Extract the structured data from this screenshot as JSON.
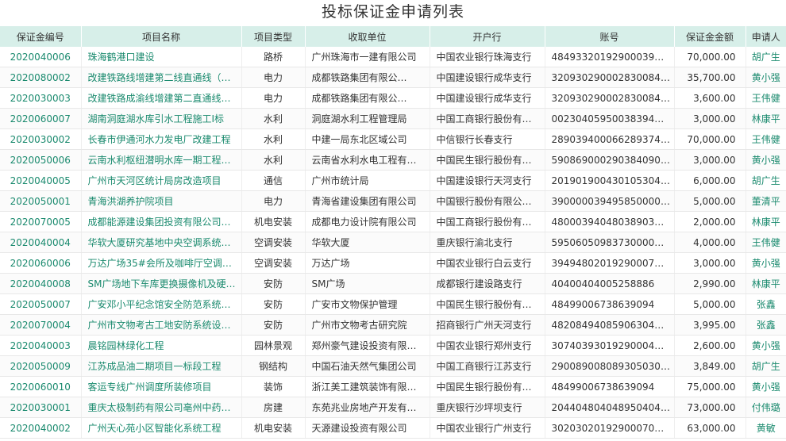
{
  "title": "投标保证金申请列表",
  "columns": [
    "保证金编号",
    "项目名称",
    "项目类型",
    "收取单位",
    "开户行",
    "账号",
    "保证金金额",
    "申请人"
  ],
  "rows": [
    {
      "code": "2020040006",
      "name": "珠海鹤港口建设",
      "type": "路桥",
      "unit": "广州珠海市一建有限公司",
      "bank": "中国农业银行珠海支行",
      "account": "48493320192900039…",
      "amount": "70,000.00",
      "applicant": "胡广生"
    },
    {
      "code": "2020080002",
      "name": "改建铁路线增建第二线直通线（…",
      "type": "电力",
      "unit": "成都铁路集团有限公…",
      "bank": "中国建设银行成华支行",
      "account": "32093029000283008404",
      "amount": "35,700.00",
      "applicant": "黄小强"
    },
    {
      "code": "2020030003",
      "name": "改建铁路成渝线增建第二直通线…",
      "type": "电力",
      "unit": "成都铁路集团有限公…",
      "bank": "中国建设银行成华支行",
      "account": "32093029000283008404",
      "amount": "3,600.00",
      "applicant": "王伟健"
    },
    {
      "code": "2020060007",
      "name": "湖南洞庭湖水库引水工程施工I标",
      "type": "水利",
      "unit": "洞庭湖水利工程管理局",
      "bank": "中国工商银行股份有…",
      "account": "00230405950038394…",
      "amount": "3,000.00",
      "applicant": "林康平"
    },
    {
      "code": "2020030002",
      "name": "长春市伊通河水力发电厂改建工程",
      "type": "水利",
      "unit": "中建一局东北区域公司",
      "bank": "中信银行长春支行",
      "account": "28903940006628937495",
      "amount": "70,000.00",
      "applicant": "王伟健"
    },
    {
      "code": "2020050006",
      "name": "云南水利枢纽潜明水库一期工程…",
      "type": "水利",
      "unit": "云南省水利水电工程有…",
      "bank": "中国民生银行股份有…",
      "account": "59086900029038409094",
      "amount": "3,000.00",
      "applicant": "黄小强"
    },
    {
      "code": "2020040005",
      "name": "广州市天河区统计局房改造项目",
      "type": "通信",
      "unit": "广州市统计局",
      "bank": "中国建设银行天河支行",
      "account": "20190190043010530494",
      "amount": "6,000.00",
      "applicant": "胡广生"
    },
    {
      "code": "2020050001",
      "name": "青海洪湖养护院项目",
      "type": "电力",
      "unit": "青海省建设集团有限公司",
      "bank": "中国银行股份有限公…",
      "account": "39000003949585000000",
      "amount": "5,000.00",
      "applicant": "董清平"
    },
    {
      "code": "2020070005",
      "name": "成都能源建设集团投资有限公司…",
      "type": "机电安装",
      "unit": "成都电力设计院有限公司",
      "bank": "中国工商银行股份有…",
      "account": "48000394048038903…",
      "amount": "2,000.00",
      "applicant": "林康平"
    },
    {
      "code": "2020040004",
      "name": "华软大厦研究基地中央空调系统…",
      "type": "空调安装",
      "unit": "华软大厦",
      "bank": "重庆银行渝北支行",
      "account": "59506050983730000…",
      "amount": "4,000.00",
      "applicant": "王伟健"
    },
    {
      "code": "2020060006",
      "name": "万达广场35#会所及咖啡厅空调安…",
      "type": "空调安装",
      "unit": "万达广场",
      "bank": "中国农业银行白云支行",
      "account": "39494802019290007…",
      "amount": "3,000.00",
      "applicant": "黄小强"
    },
    {
      "code": "2020040008",
      "name": "SM广场地下车库更换摄像机及硬…",
      "type": "安防",
      "unit": "SM广场",
      "bank": "成都银行建设路支行",
      "account": "40400404005258886",
      "amount": "2,990.00",
      "applicant": "林康平"
    },
    {
      "code": "2020050007",
      "name": "广安邓小平纪念馆安全防范系统…",
      "type": "安防",
      "unit": "广安市文物保护管理",
      "bank": "中国民生银行股份有…",
      "account": "48499006738639094",
      "amount": "5,000.00",
      "applicant": "张鑫"
    },
    {
      "code": "2020070004",
      "name": "广州市文物考古工地安防系统设…",
      "type": "安防",
      "unit": "广州市文物考古研究院",
      "bank": "招商银行广州天河支行",
      "account": "48208494085906304…",
      "amount": "3,995.00",
      "applicant": "张鑫"
    },
    {
      "code": "2020040003",
      "name": "晨铭园林绿化工程",
      "type": "园林景观",
      "unit": "郑州豪气建设投资有限…",
      "bank": "中国农业银行郑州支行",
      "account": "30740393019290004…",
      "amount": "2,600.00",
      "applicant": "黄小强"
    },
    {
      "code": "2020050009",
      "name": "江苏成品油二期项目一标段工程",
      "type": "钢结构",
      "unit": "中国石油天然气集团公司",
      "bank": "中国工商银行江苏支行",
      "account": "29008900808930503033",
      "amount": "3,849.00",
      "applicant": "胡广生"
    },
    {
      "code": "2020060010",
      "name": "客运专线广州调度所装修项目",
      "type": "装饰",
      "unit": "浙江美工建筑装饰有限…",
      "bank": "中国民生银行股份有…",
      "account": "48499006738639094",
      "amount": "75,000.00",
      "applicant": "黄小强"
    },
    {
      "code": "2020030001",
      "name": "重庆太极制药有限公司亳州中药…",
      "type": "房建",
      "unit": "东苑兆业房地产开发有…",
      "bank": "重庆银行沙坪坝支行",
      "account": "20440480404895040480",
      "amount": "73,000.00",
      "applicant": "付伟璐"
    },
    {
      "code": "2020040002",
      "name": "广州天心苑小区智能化系统工程",
      "type": "机电安装",
      "unit": "天源建设投资有限公司",
      "bank": "中国农业银行广州支行",
      "account": "30203020192900070…",
      "amount": "63,000.00",
      "applicant": "黄敏"
    }
  ]
}
